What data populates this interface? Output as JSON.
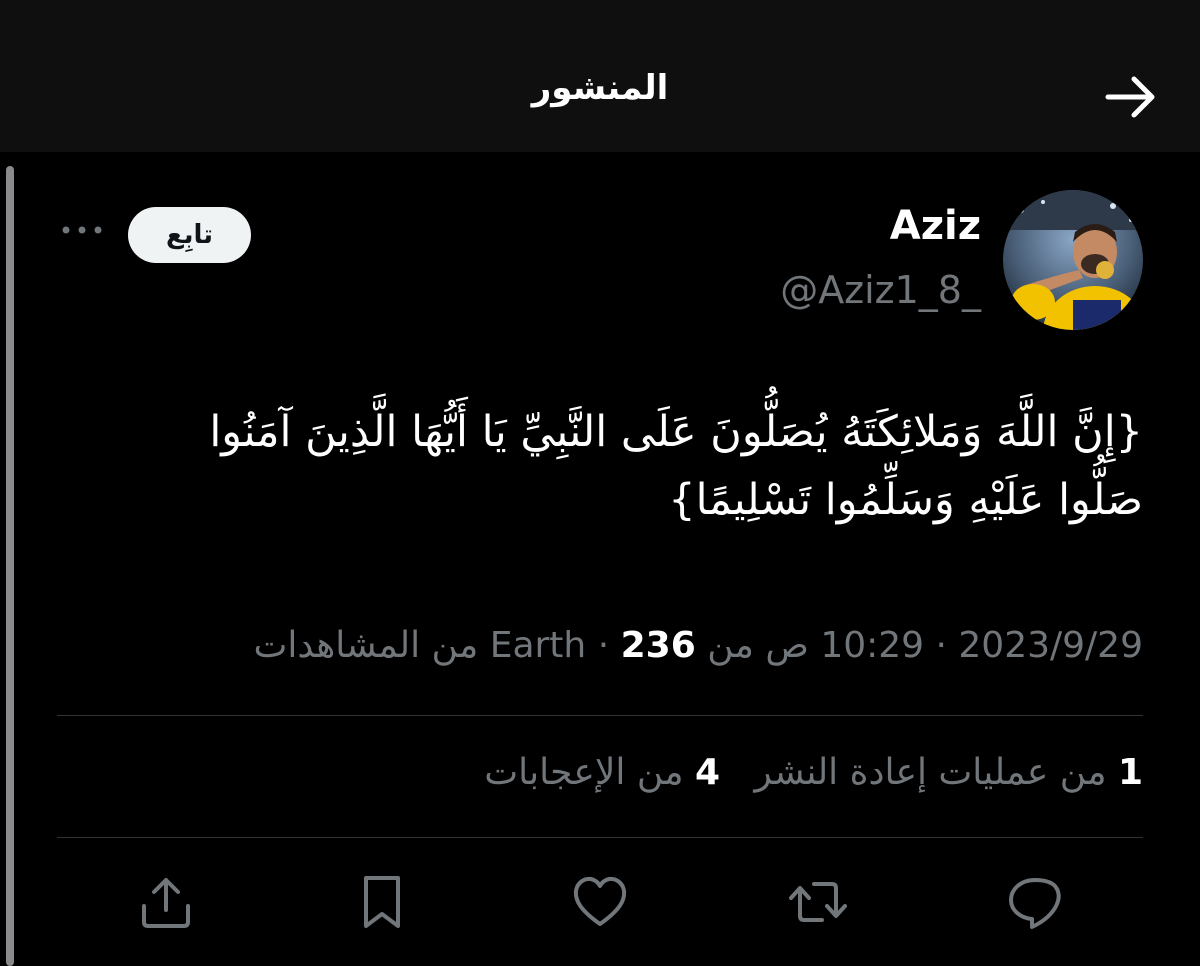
{
  "header": {
    "title": "المنشور",
    "back_icon": "arrow-right-icon"
  },
  "author": {
    "name": "Aziz",
    "handle": "@Aziz1_8_",
    "avatar_icon": "profile-photo"
  },
  "follow_label": "تابِع",
  "tweet": {
    "line1": "{إِنَّ اللَّهَ وَمَلائِكَتَهُ يُصَلُّونَ عَلَى النَّبِيِّ يَا أَيُّهَا الَّذِينَ آمَنُوا",
    "line2": "صَلُّوا عَلَيْهِ وَسَلِّمُوا تَسْلِيمًا}"
  },
  "meta": {
    "date": "2023/9/29",
    "time": "10:29 ص",
    "source": "من Earth",
    "views_count": "236",
    "views_label": "من المشاهدات"
  },
  "stats": {
    "retweets_count": "1",
    "retweets_label": "من عمليات إعادة النشر",
    "likes_count": "4",
    "likes_label": "من الإعجابات"
  },
  "colors": {
    "background": "#000000",
    "header_background": "#0f0f10",
    "secondary_text": "#71767b",
    "divider": "#2f3336"
  }
}
